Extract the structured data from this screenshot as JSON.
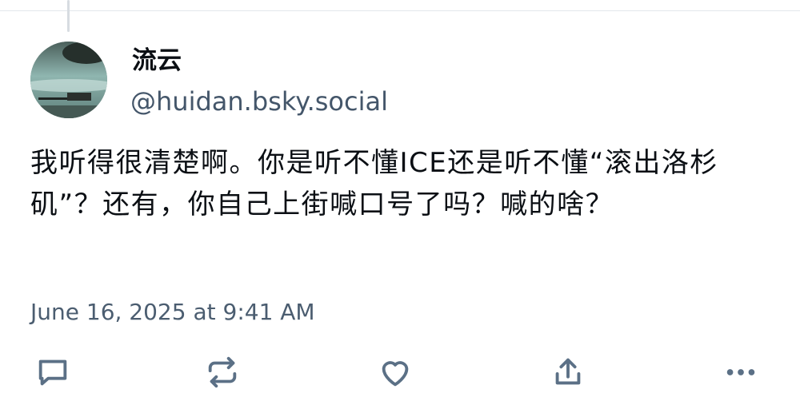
{
  "post": {
    "author": {
      "display_name": "流云",
      "handle": "@huidan.bsky.social",
      "avatar_icon": "avatar-image"
    },
    "text": "我听得很清楚啊。你是听不懂ICE还是听不懂“滚出洛杉矶”？还有，你自己上街喊口号了吗？喊的啥？",
    "timestamp": "June 16, 2025 at 9:41 AM"
  },
  "actions": [
    {
      "name": "reply",
      "icon": "reply-icon"
    },
    {
      "name": "repost",
      "icon": "repost-icon"
    },
    {
      "name": "like",
      "icon": "heart-icon"
    },
    {
      "name": "share",
      "icon": "share-icon"
    },
    {
      "name": "more",
      "icon": "more-icon"
    }
  ],
  "colors": {
    "text": "#0b0f14",
    "muted": "#44566a",
    "icon": "#5b7086",
    "divider": "#e3e7eb"
  }
}
